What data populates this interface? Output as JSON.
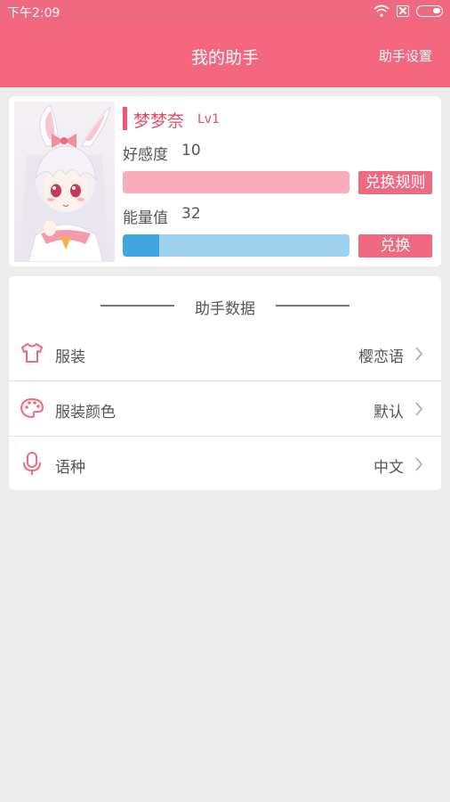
{
  "status_bar": {
    "time": "下午2:09",
    "icons": [
      "wifi-icon",
      "sim-icon",
      "battery-icon"
    ]
  },
  "app_bar": {
    "title": "我的助手",
    "settings_label": "助手设置"
  },
  "profile": {
    "name": "梦梦奈",
    "level": "Lv1",
    "favor_label": "好感度",
    "favor_value": "10",
    "favor_progress": 0,
    "rules_button": "兑换规则",
    "energy_label": "能量值",
    "energy_value": "32",
    "energy_progress": 0.16,
    "exchange_button": "兑换"
  },
  "data_section": {
    "title": "助手数据",
    "rows": [
      {
        "icon": "clothing-icon",
        "label": "服装",
        "value": "樱恋语"
      },
      {
        "icon": "palette-icon",
        "label": "服装颜色",
        "value": "默认"
      },
      {
        "icon": "microphone-icon",
        "label": "语种",
        "value": "中文"
      }
    ]
  },
  "colors": {
    "accent": "#f5677f",
    "name_color": "#e24b6a",
    "favor_bar": "#f9adbb",
    "energy_bar_bg": "#9ed3f0",
    "energy_bar_fill": "#3ea7e0",
    "background": "#ececec"
  }
}
